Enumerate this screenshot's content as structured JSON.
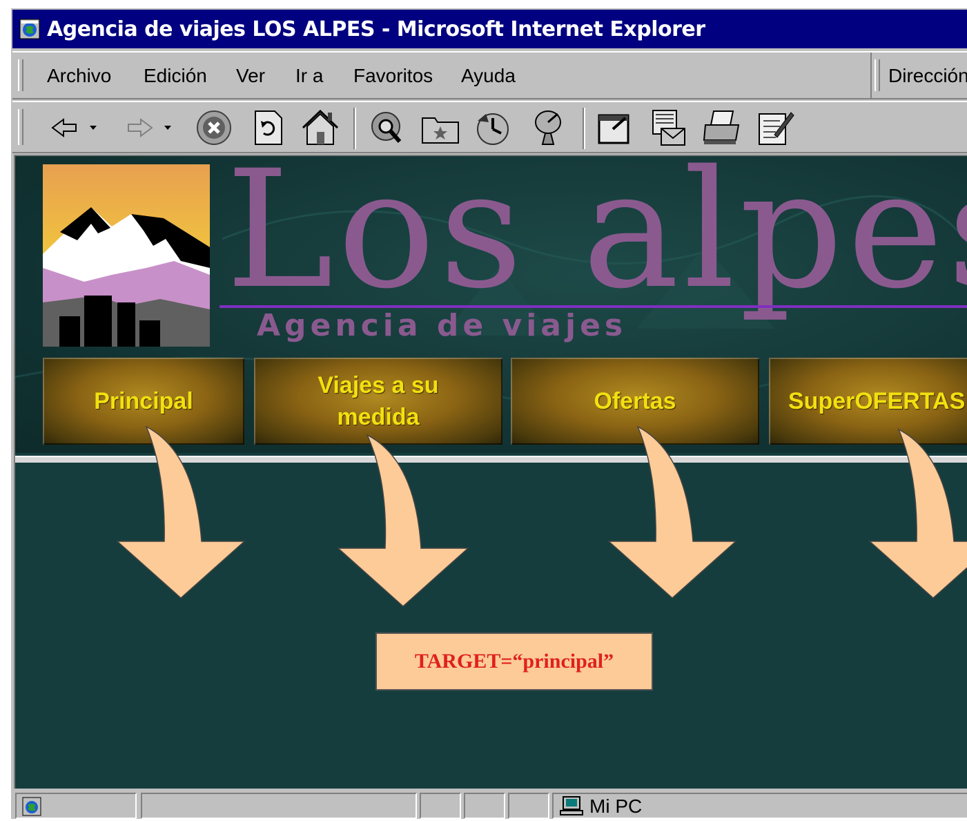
{
  "window": {
    "title": "Agencia de viajes LOS ALPES - Microsoft Internet Explorer"
  },
  "menu": {
    "items": [
      {
        "label": "Archivo"
      },
      {
        "label": "Edición"
      },
      {
        "label": "Ver"
      },
      {
        "label": "Ir a"
      },
      {
        "label": "Favoritos"
      },
      {
        "label": "Ayuda"
      }
    ],
    "address_label": "Dirección"
  },
  "toolbar": {
    "icons": [
      "back-icon",
      "forward-icon",
      "stop-icon",
      "refresh-icon",
      "home-icon",
      "search-icon",
      "favorites-icon",
      "history-icon",
      "channels-icon",
      "fullscreen-icon",
      "mail-icon",
      "print-icon",
      "edit-icon"
    ]
  },
  "banner": {
    "brand": "Los alpes",
    "subtitle": "Agencia de viajes"
  },
  "nav": {
    "buttons": [
      {
        "label": "Principal"
      },
      {
        "label": "Viajes a su medida"
      },
      {
        "label": "Ofertas"
      },
      {
        "label": "SuperOFERTAS"
      }
    ]
  },
  "annotation": {
    "text": "TARGET=“principal”",
    "box_color": "#fdcb97",
    "text_color": "#e0201f",
    "arrow_color": "#fdcb97"
  },
  "statusbar": {
    "zone": "Mi PC"
  },
  "colors": {
    "titlebar": "#000080",
    "page_background": "#163d3d",
    "brand_text": "#8a5a8f",
    "nav_text": "#f2e010"
  }
}
